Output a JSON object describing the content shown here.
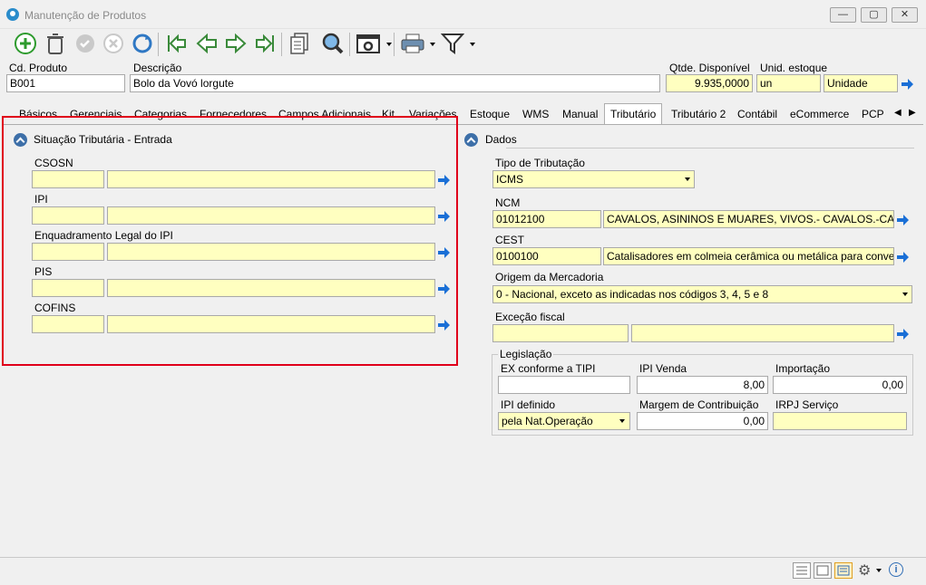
{
  "window": {
    "title": "Manutenção de Produtos",
    "minimize": "—",
    "restore": "▢",
    "close": "✕"
  },
  "header": {
    "cd_produto_label": "Cd. Produto",
    "cd_produto_value": "B001",
    "descricao_label": "Descrição",
    "descricao_value": "Bolo da Vovó lorgute",
    "qtde_label": "Qtde. Disponível",
    "qtde_value": "9.935,0000",
    "unid_label": "Unid. estoque",
    "unid_code": "un",
    "unid_desc": "Unidade"
  },
  "tabs": [
    "Básicos",
    "Gerenciais",
    "Categorias",
    "Fornecedores",
    "Campos Adicionais",
    "Kit",
    "Variações",
    "Estoque",
    "WMS",
    "Manual",
    "Tributário",
    "Tributário 2",
    "Contábil",
    "eCommerce",
    "PCP"
  ],
  "active_tab": "Tributário",
  "left": {
    "title": "Situação Tributária - Entrada",
    "fields": [
      {
        "label": "CSOSN",
        "code": "",
        "desc": ""
      },
      {
        "label": "IPI",
        "code": "",
        "desc": ""
      },
      {
        "label": "Enquadramento Legal do IPI",
        "code": "",
        "desc": ""
      },
      {
        "label": "PIS",
        "code": "",
        "desc": ""
      },
      {
        "label": "COFINS",
        "code": "",
        "desc": ""
      }
    ]
  },
  "right": {
    "title": "Dados",
    "tipo_label": "Tipo de Tributação",
    "tipo_value": "ICMS",
    "ncm_label": "NCM",
    "ncm_code": "01012100",
    "ncm_desc": "CAVALOS, ASININOS E MUARES, VIVOS.- CAVALOS.-CAVALOS",
    "cest_label": "CEST",
    "cest_code": "0100100",
    "cest_desc": "Catalisadores em colmeia cerâmica ou metálica para conversão cat",
    "origem_label": "Origem da Mercadoria",
    "origem_value": "0 - Nacional, exceto as indicadas nos códigos 3, 4, 5 e 8",
    "excecao_label": "Exceção fiscal",
    "excecao_code": "",
    "excecao_desc": "",
    "legislacao": {
      "title": "Legislação",
      "ex_tipi_label": "EX conforme a TIPI",
      "ex_tipi_value": "",
      "ipi_venda_label": "IPI Venda",
      "ipi_venda_value": "8,00",
      "importacao_label": "Importação",
      "importacao_value": "0,00",
      "ipi_definido_label": "IPI definido",
      "ipi_definido_value": "pela Nat.Operação",
      "margem_label": "Margem de Contribuição",
      "margem_value": "0,00",
      "irpj_label": "IRPJ Serviço",
      "irpj_value": ""
    }
  },
  "colors": {
    "yellow_field": "#ffffc0",
    "highlight": "#e0001a",
    "section_icon": "#3d6fa8",
    "arrow": "#1a6fd6"
  }
}
